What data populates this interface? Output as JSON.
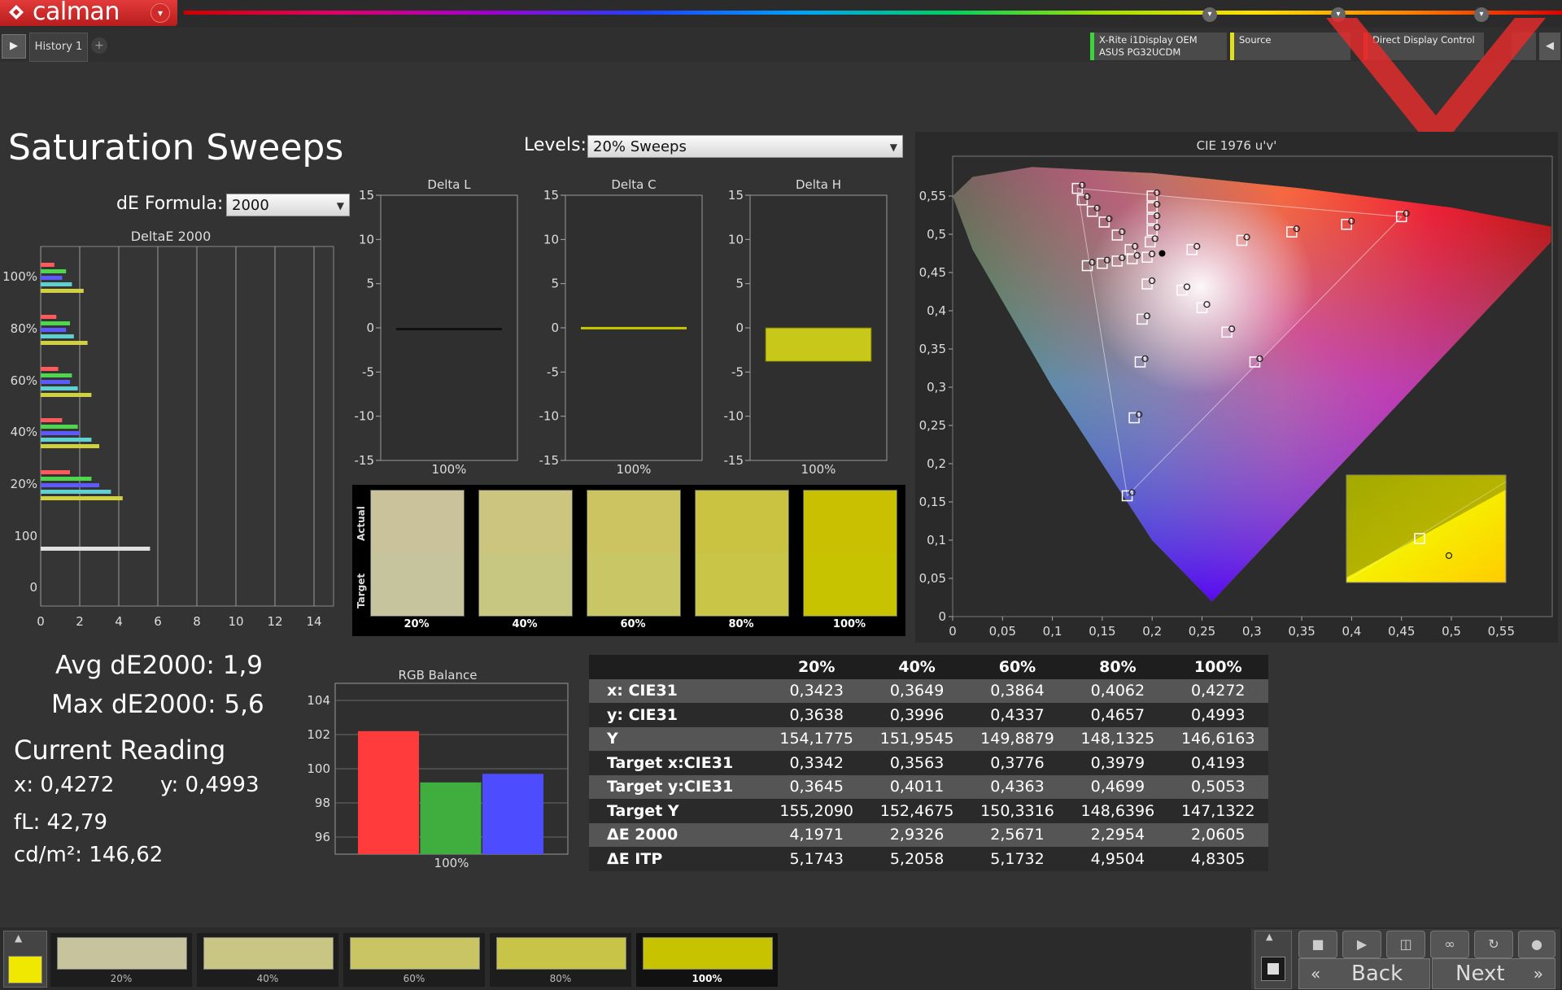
{
  "app": {
    "name": "calman",
    "history_tab": "History 1",
    "devices": [
      {
        "line1": "X-Rite i1Display OEM",
        "line2": "ASUS PG32UCDM",
        "color": "#3bd43b"
      },
      {
        "line1": "Source",
        "line2": "",
        "color": "#e0e020"
      },
      {
        "line1": "Direct Display Control",
        "line2": "",
        "color": "#e03030"
      }
    ]
  },
  "header": {
    "title": "Saturation Sweeps",
    "levels_label": "Levels:",
    "levels_value": "20% Sweeps",
    "de_formula_label": "dE Formula:",
    "de_formula_value": "2000"
  },
  "deltae_chart": {
    "title": "DeltaE 2000",
    "xticks": [
      "0",
      "2",
      "4",
      "6",
      "8",
      "10",
      "12",
      "14"
    ],
    "ylabels": [
      "100%",
      "80%",
      "60%",
      "40%",
      "20%",
      "100",
      "0"
    ],
    "xmax": 15,
    "groups": [
      {
        "label": "100%",
        "values": [
          0.7,
          1.3,
          1.1,
          1.6,
          2.2
        ]
      },
      {
        "label": "80%",
        "values": [
          0.8,
          1.5,
          1.3,
          1.7,
          2.4
        ]
      },
      {
        "label": "60%",
        "values": [
          0.9,
          1.6,
          1.5,
          1.9,
          2.6
        ]
      },
      {
        "label": "40%",
        "values": [
          1.1,
          1.9,
          2.0,
          2.6,
          3.0
        ]
      },
      {
        "label": "20%",
        "values": [
          1.5,
          2.6,
          3.0,
          3.6,
          4.2
        ]
      },
      {
        "label": "100",
        "values": [
          5.6
        ]
      }
    ],
    "bar_colors": [
      "#ff5b5b",
      "#4fd64f",
      "#5b5bff",
      "#5fd0d0",
      "#d0d040"
    ]
  },
  "delta_charts": [
    {
      "title": "Delta L",
      "xlabel": "100%",
      "value": 0.0,
      "color": "#111111"
    },
    {
      "title": "Delta C",
      "xlabel": "100%",
      "value": 0.1,
      "color": "#c8c800"
    },
    {
      "title": "Delta H",
      "xlabel": "100%",
      "value": -3.8,
      "color": "#c8c81a"
    }
  ],
  "delta_yticks": [
    "15",
    "10",
    "5",
    "0",
    "-5",
    "-10",
    "-15"
  ],
  "swatches": {
    "actual_label": "Actual",
    "target_label": "Target",
    "items": [
      {
        "label": "20%",
        "actual": "#c9c29b",
        "target": "#c6c49d"
      },
      {
        "label": "40%",
        "actual": "#ccc57f",
        "target": "#c8c782"
      },
      {
        "label": "60%",
        "actual": "#cbc460",
        "target": "#c9c665"
      },
      {
        "label": "80%",
        "actual": "#c9c341",
        "target": "#c8c547"
      },
      {
        "label": "100%",
        "actual": "#c8c000",
        "target": "#c8c300"
      }
    ]
  },
  "cie": {
    "title": "CIE 1976 u'v'",
    "xticks": [
      "0",
      "0,05",
      "0,1",
      "0,15",
      "0,2",
      "0,25",
      "0,3",
      "0,35",
      "0,4",
      "0,45",
      "0,5",
      "0,55"
    ],
    "yticks": [
      "0",
      "0,05",
      "0,1",
      "0,15",
      "0,2",
      "0,25",
      "0,3",
      "0,35",
      "0,4",
      "0,45",
      "0,5",
      "0,55"
    ]
  },
  "readouts": {
    "avg": "Avg dE2000: 1,9",
    "max": "Max dE2000: 5,6",
    "current_title": "Current Reading",
    "x": "x: 0,4272",
    "y": "y: 0,4993",
    "fl": "fL: 42,79",
    "cdm2": "cd/m²: 146,62"
  },
  "rgb_balance": {
    "title": "RGB Balance",
    "xlabel": "100%",
    "yticks": [
      "104",
      "102",
      "100",
      "98",
      "96"
    ],
    "ymin": 95,
    "ymax": 105,
    "values": [
      102.2,
      99.2,
      99.7
    ],
    "colors": [
      "#ff3b3b",
      "#3fae3f",
      "#4d4dff"
    ]
  },
  "table": {
    "headers": [
      "",
      "20%",
      "40%",
      "60%",
      "80%",
      "100%"
    ],
    "rows": [
      [
        "x: CIE31",
        "0,3423",
        "0,3649",
        "0,3864",
        "0,4062",
        "0,4272"
      ],
      [
        "y: CIE31",
        "0,3638",
        "0,3996",
        "0,4337",
        "0,4657",
        "0,4993"
      ],
      [
        "Y",
        "154,1775",
        "151,9545",
        "149,8879",
        "148,1325",
        "146,6163"
      ],
      [
        "Target x:CIE31",
        "0,3342",
        "0,3563",
        "0,3776",
        "0,3979",
        "0,4193"
      ],
      [
        "Target y:CIE31",
        "0,3645",
        "0,4011",
        "0,4363",
        "0,4699",
        "0,5053"
      ],
      [
        "Target Y",
        "155,2090",
        "152,4675",
        "150,3316",
        "148,6396",
        "147,1322"
      ],
      [
        "ΔE 2000",
        "4,1971",
        "2,9326",
        "2,5671",
        "2,2954",
        "2,0605"
      ],
      [
        "ΔE ITP",
        "5,1743",
        "5,2058",
        "5,1732",
        "4,9504",
        "4,8305"
      ]
    ]
  },
  "bottom": {
    "current_color": "#f0e800",
    "thumbs": [
      {
        "label": "20%",
        "color": "#c6c39d"
      },
      {
        "label": "40%",
        "color": "#c8c682"
      },
      {
        "label": "60%",
        "color": "#c9c565"
      },
      {
        "label": "80%",
        "color": "#c8c447"
      },
      {
        "label": "100%",
        "color": "#c8c300"
      }
    ],
    "back": "Back",
    "next": "Next"
  }
}
